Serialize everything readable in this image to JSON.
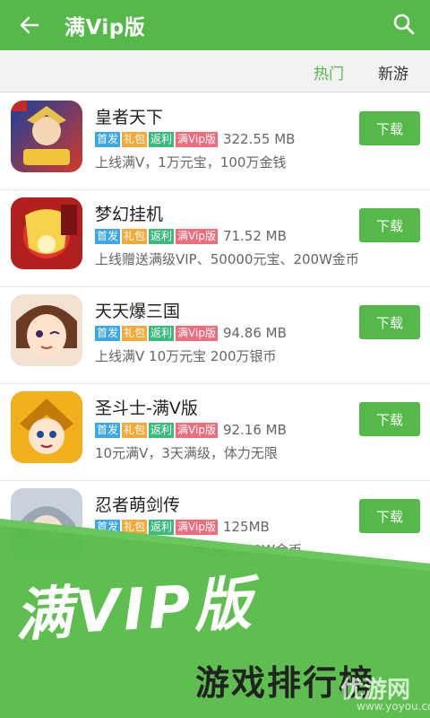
{
  "header": {
    "title": "满Vip版",
    "back_icon": "arrow-left-icon",
    "search_icon": "search-icon"
  },
  "tabs": [
    {
      "label": "热门",
      "active": true
    },
    {
      "label": "新游",
      "active": false
    }
  ],
  "download_label": "下载",
  "apps": [
    {
      "name": "皇者天下",
      "tags": [
        "首发",
        "礼包",
        "返利",
        "满Vip版"
      ],
      "size": "322.55 MB",
      "desc": "上线满V，1万元宝，100万金钱"
    },
    {
      "name": "梦幻挂机",
      "tags": [
        "首发",
        "礼包",
        "返利",
        "满Vip版"
      ],
      "size": "71.52 MB",
      "desc": "上线赠送满级VIP、50000元宝、200W金币"
    },
    {
      "name": "天天爆三国",
      "tags": [
        "首发",
        "礼包",
        "返利",
        "满Vip版"
      ],
      "size": "94.86 MB",
      "desc": "上线满V 10万元宝 200万银币"
    },
    {
      "name": "圣斗士-满V版",
      "tags": [
        "首发",
        "礼包",
        "返利",
        "满Vip版"
      ],
      "size": "92.16 MB",
      "desc": "10元满V，3天满级，体力无限"
    },
    {
      "name": "忍者萌剑传",
      "tags": [
        "首发",
        "礼包",
        "返利",
        "满Vip版"
      ],
      "size": "125MB",
      "desc": "W钻石 100W金币"
    }
  ],
  "promo": {
    "headline": "满VIP版",
    "subhead": "游戏排行榜"
  },
  "watermark": {
    "logo": "优游网",
    "url": "www.yoyou.com"
  },
  "colors": {
    "accent": "#54b948",
    "tag_first": "#3aa8e6",
    "tag_gift": "#f4a93b",
    "tag_rebate": "#3dbb7c",
    "tag_vip": "#f26b7b"
  }
}
